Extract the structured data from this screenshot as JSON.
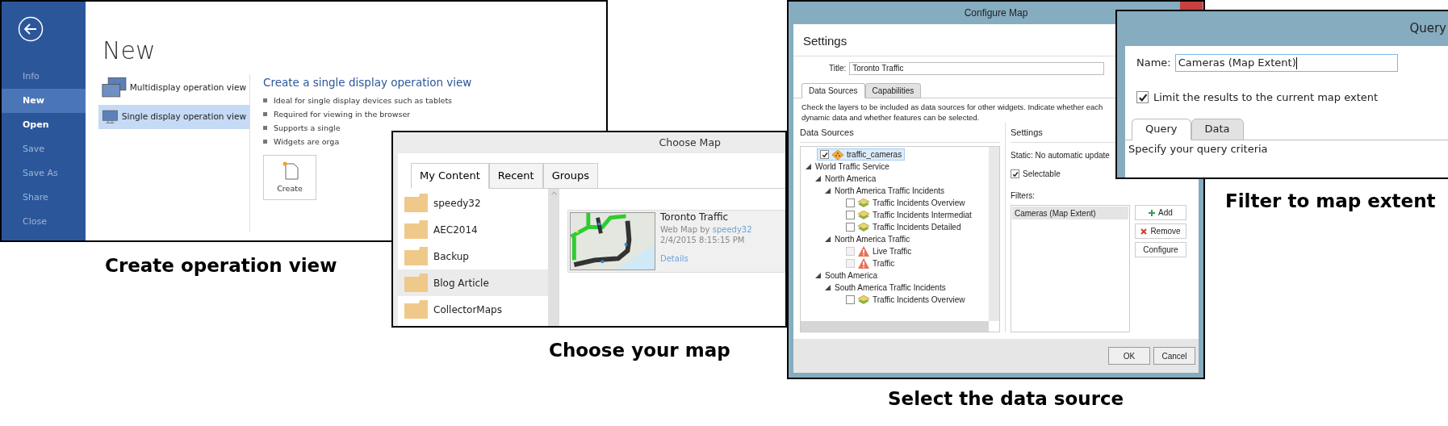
{
  "backstage": {
    "sidebar": [
      {
        "label": "Info",
        "selected": false,
        "disabled": true
      },
      {
        "label": "New",
        "selected": true,
        "disabled": false
      },
      {
        "label": "Open",
        "selected": false,
        "disabled": false
      },
      {
        "label": "Save",
        "selected": false,
        "disabled": true
      },
      {
        "label": "Save As",
        "selected": false,
        "disabled": true
      },
      {
        "label": "Share",
        "selected": false,
        "disabled": true
      },
      {
        "label": "Close",
        "selected": false,
        "disabled": true
      }
    ],
    "heading": "New",
    "options": [
      {
        "label": "Multidisplay operation view",
        "kind": "multi",
        "selected": false
      },
      {
        "label": "Single display operation view",
        "kind": "single",
        "selected": true
      }
    ],
    "detail_title": "Create a single display operation view",
    "bullets": [
      "Ideal for single display devices such as tablets",
      "Required for viewing in the browser",
      "Supports a single",
      "Widgets are orga"
    ],
    "create_button": "Create",
    "caption": "Create operation view"
  },
  "choose_map": {
    "title": "Choose Map",
    "tabs": [
      {
        "label": "My Content",
        "selected": true
      },
      {
        "label": "Recent",
        "selected": false
      },
      {
        "label": "Groups",
        "selected": false
      }
    ],
    "folders": [
      {
        "label": "speedy32",
        "selected": false
      },
      {
        "label": "AEC2014",
        "selected": false
      },
      {
        "label": "Backup",
        "selected": false
      },
      {
        "label": "Blog Article",
        "selected": true
      },
      {
        "label": "CollectorMaps",
        "selected": false
      }
    ],
    "map_card": {
      "title": "Toronto Traffic",
      "type": "Web Map by",
      "owner": "speedy32",
      "date": "2/4/2015 8:15:15 PM",
      "link": "Details"
    },
    "caption": "Choose your map"
  },
  "configure_map": {
    "title": "Configure Map",
    "heading": "Settings",
    "title_label": "Title:",
    "title_value": "Toronto Traffic",
    "tabs": [
      {
        "label": "Data Sources",
        "selected": true
      },
      {
        "label": "Capabilities",
        "selected": false
      }
    ],
    "description": [
      "Check the layers to be included as data sources for other widgets. Indicate whether each",
      "dynamic data and whether features can be selected."
    ],
    "sources_header": "Data Sources",
    "settings_header": "Settings",
    "tree": [
      {
        "label": "traffic_cameras",
        "kind": "point",
        "checked": true,
        "disabled": false,
        "selected": true
      },
      {
        "label": "World Traffic Service",
        "kind": "group",
        "expanded": true,
        "children": [
          {
            "label": "North America",
            "kind": "group",
            "expanded": true,
            "children": [
              {
                "label": "North America Traffic Incidents",
                "kind": "group",
                "expanded": true,
                "children": [
                  {
                    "label": "Traffic Incidents Overview",
                    "kind": "layers",
                    "checked": false,
                    "disabled": false,
                    "selected": false
                  },
                  {
                    "label": "Traffic Incidents Intermediat",
                    "kind": "layers",
                    "checked": false,
                    "disabled": false,
                    "selected": false
                  },
                  {
                    "label": "Traffic Incidents Detailed",
                    "kind": "layers",
                    "checked": false,
                    "disabled": false,
                    "selected": false
                  }
                ]
              },
              {
                "label": "North America Traffic",
                "kind": "group",
                "expanded": true,
                "children": [
                  {
                    "label": "Live Traffic",
                    "kind": "warning",
                    "checked": false,
                    "disabled": true,
                    "selected": false
                  },
                  {
                    "label": "Traffic",
                    "kind": "warning",
                    "checked": false,
                    "disabled": true,
                    "selected": false
                  }
                ]
              }
            ]
          },
          {
            "label": "South America",
            "kind": "group",
            "expanded": true,
            "children": [
              {
                "label": "South America Traffic Incidents",
                "kind": "group",
                "expanded": true,
                "children": [
                  {
                    "label": "Traffic Incidents Overview",
                    "kind": "layers",
                    "checked": false,
                    "disabled": false,
                    "selected": false
                  }
                ]
              }
            ]
          }
        ]
      }
    ],
    "static_text": "Static: No automatic update",
    "selectable": {
      "label": "Selectable",
      "checked": true
    },
    "filters_label": "Filters:",
    "filters": [
      {
        "label": "Cameras (Map Extent)",
        "selected": true
      }
    ],
    "filter_buttons": [
      {
        "label": "Add",
        "kind": "add"
      },
      {
        "label": "Remove",
        "kind": "remove"
      },
      {
        "label": "Configure",
        "kind": "plain"
      }
    ],
    "footer_buttons": [
      "OK",
      "Cancel"
    ],
    "caption": "Select the data source"
  },
  "query_dialog": {
    "title": "Query",
    "name_label": "Name:",
    "name_value": "Cameras (Map Extent)",
    "limit": {
      "label": "Limit the results to the current map extent",
      "checked": true
    },
    "tabs": [
      {
        "label": "Query",
        "selected": true
      },
      {
        "label": "Data",
        "selected": false
      }
    ],
    "hint": "Specify your query criteria",
    "caption": "Filter to map extent"
  }
}
